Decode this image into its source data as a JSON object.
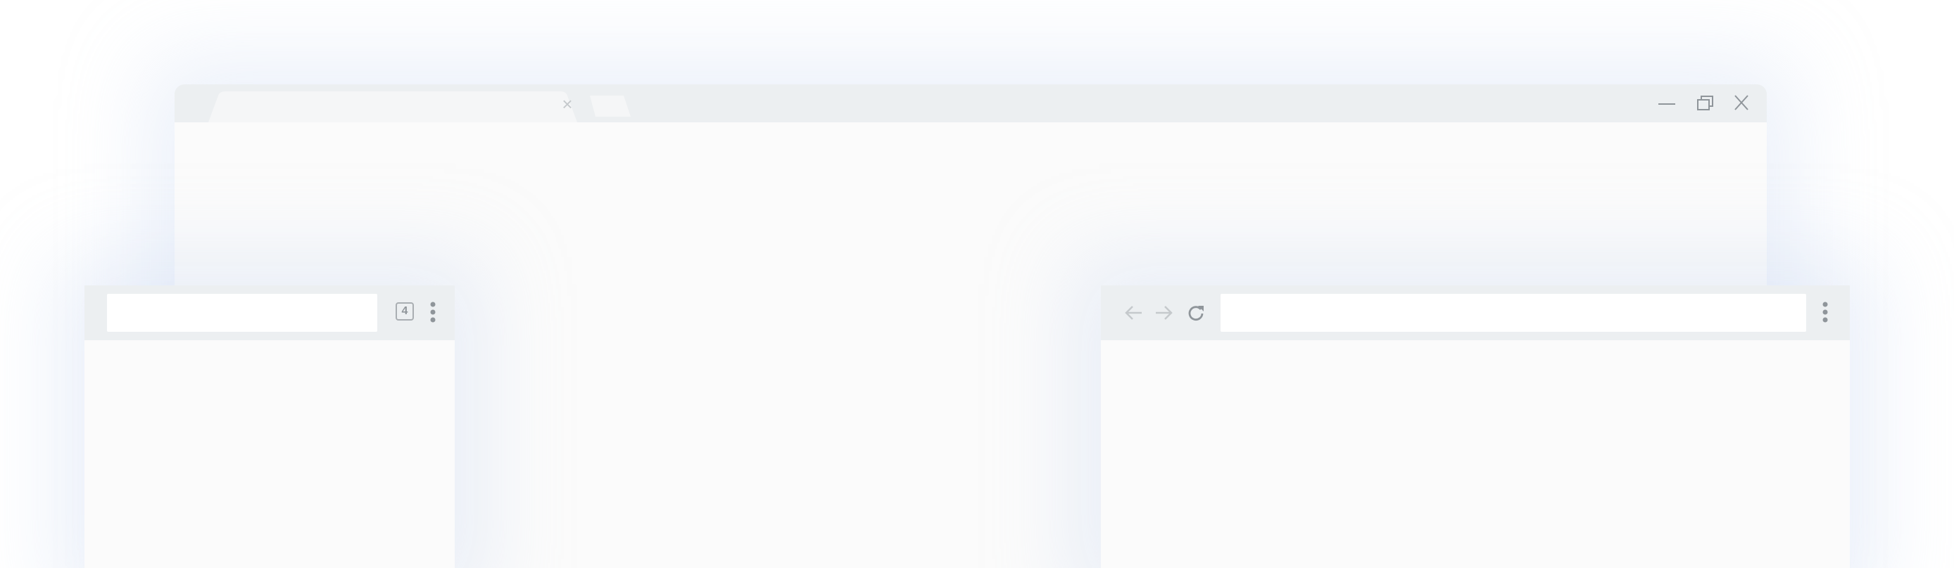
{
  "desktop": {
    "tab_close_glyph": "×",
    "icons": {
      "tab_close": "close-icon",
      "minimize": "minimize-icon",
      "restore": "restore-icon",
      "close": "close-icon"
    }
  },
  "mobile": {
    "tab_count": "4",
    "icons": {
      "tab_switcher": "tab-switcher-icon",
      "menu": "more-vert-icon"
    }
  },
  "tablet": {
    "icons": {
      "back": "arrow-back-icon",
      "forward": "arrow-forward-icon",
      "reload": "reload-icon",
      "menu": "more-vert-icon"
    }
  },
  "colors": {
    "chrome": "#eceff1",
    "content": "#fbfbfb",
    "omnibox": "#ffffff",
    "icon_muted": "#c5c9cc",
    "icon": "#8f959a"
  }
}
